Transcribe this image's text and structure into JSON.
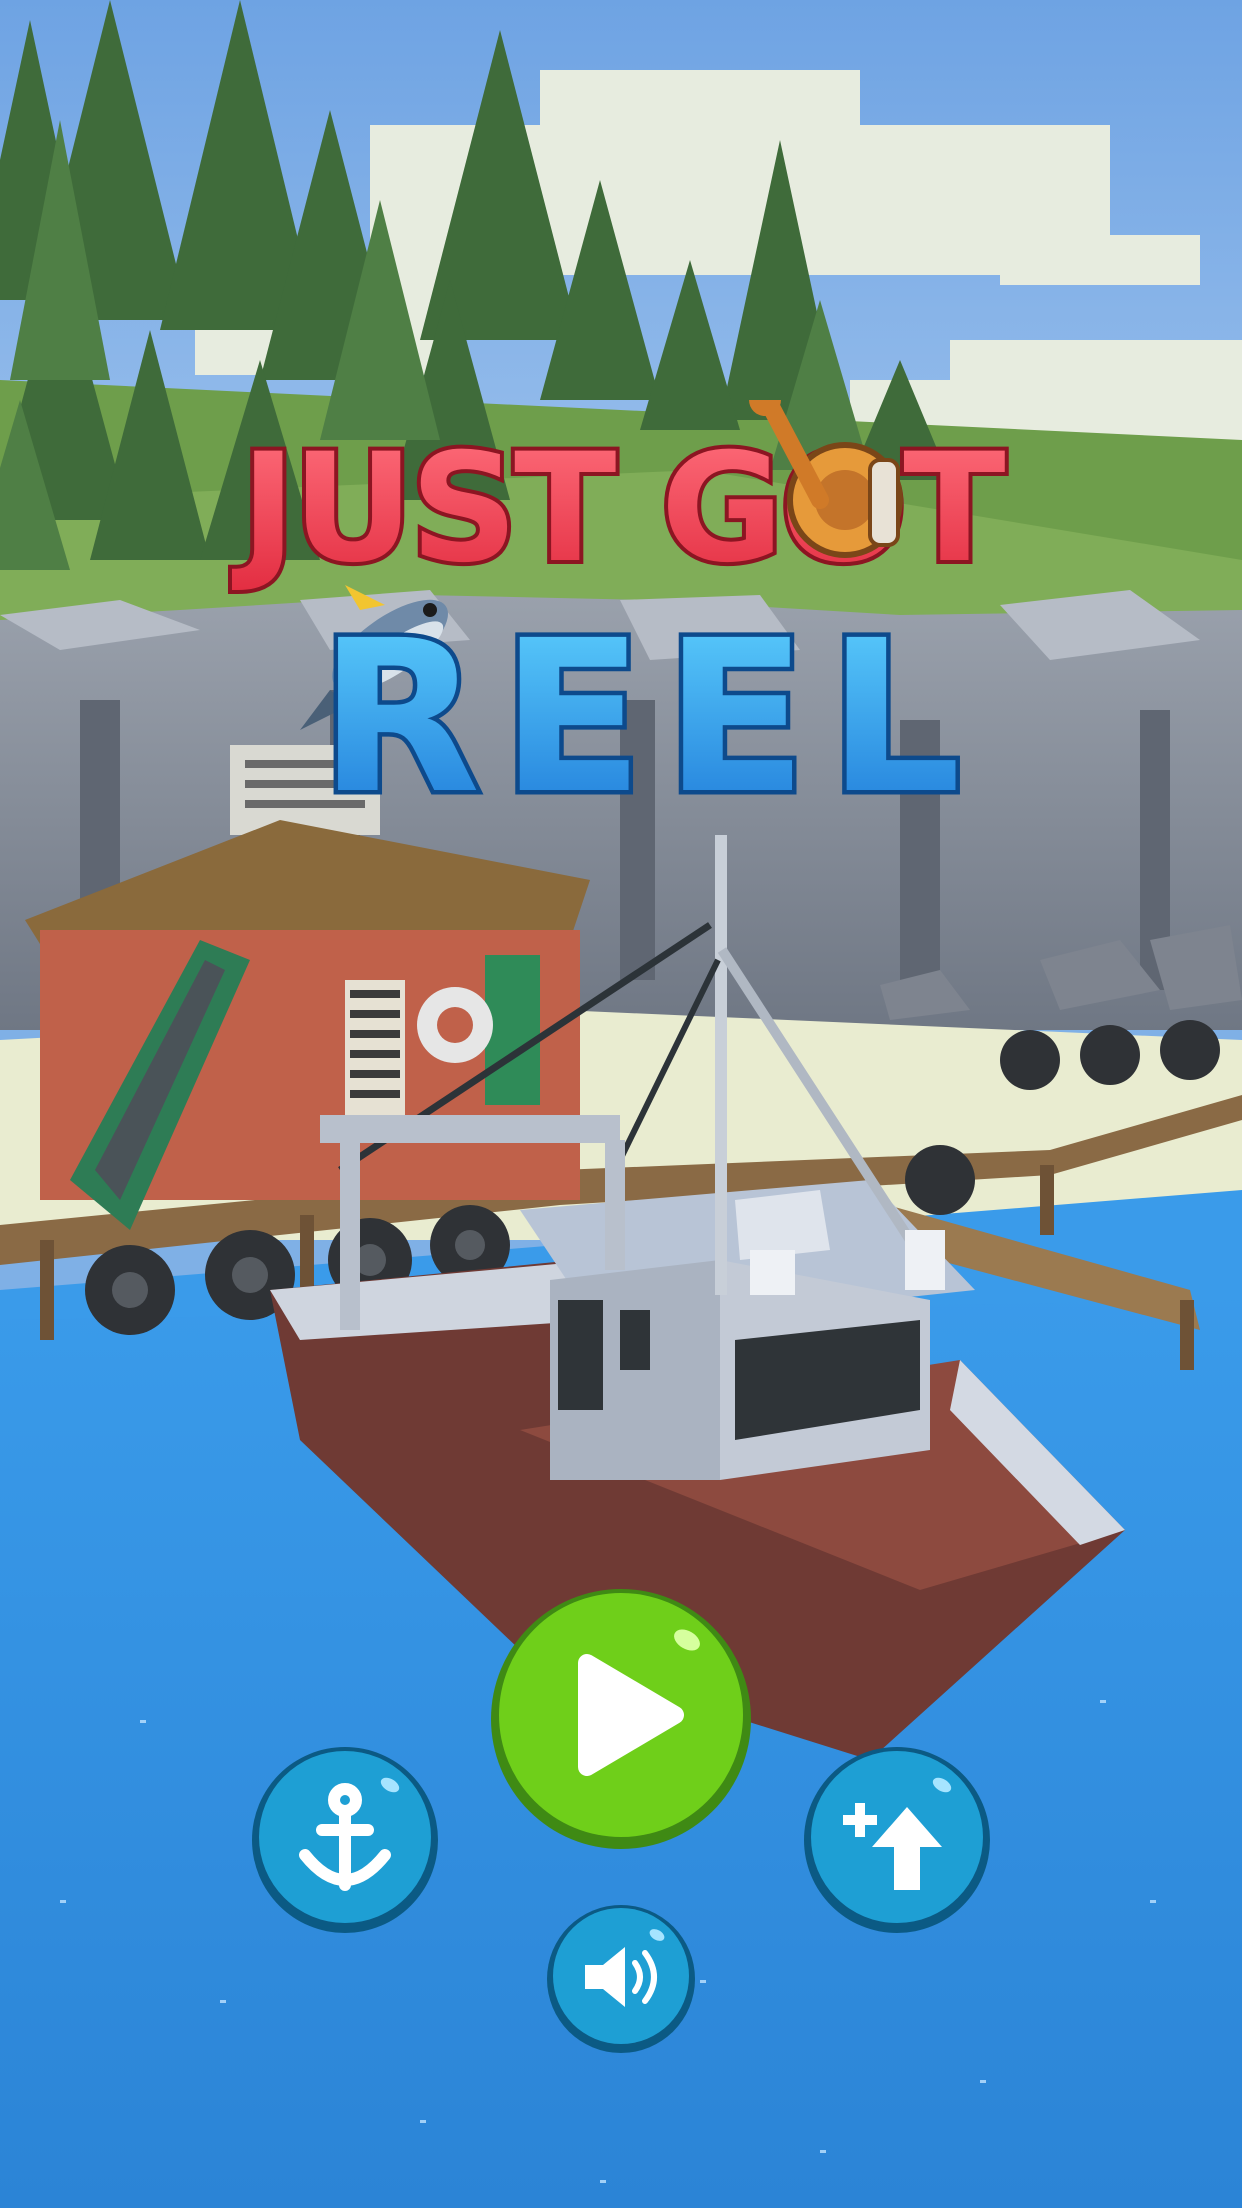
{
  "game": {
    "title_line1": "JUST GOT",
    "title_line2": "REEL"
  },
  "colors": {
    "sky": "#7aaee8",
    "water": "#2f8fe0",
    "title_red": "#f0384a",
    "title_blue": "#2aa4ee",
    "play_green": "#6fcf1a",
    "button_teal": "#1e9fd4"
  },
  "buttons": [
    {
      "name": "play-button",
      "icon": "play-icon"
    },
    {
      "name": "anchor-button",
      "icon": "anchor-icon"
    },
    {
      "name": "upgrade-button",
      "icon": "plus-arrow-up-icon"
    },
    {
      "name": "sound-button",
      "icon": "speaker-icon"
    }
  ]
}
